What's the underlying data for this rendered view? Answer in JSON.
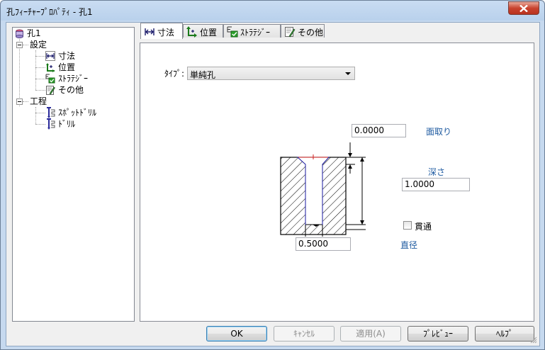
{
  "window": {
    "title": "孔ﾌｨｰﾁｬｰﾌﾟﾛﾊﾟﾃｨ - 孔1"
  },
  "tree": {
    "root": "孔1",
    "groups": [
      {
        "label": "設定",
        "items": [
          "寸法",
          "位置",
          "ｽﾄﾗﾃｼﾞｰ",
          "その他"
        ]
      },
      {
        "label": "工程",
        "items": [
          "ｽﾎﾟｯﾄﾄﾞﾘﾙ",
          "ﾄﾞﾘﾙ"
        ]
      }
    ]
  },
  "tabs": [
    {
      "label": "寸法",
      "icon": "dimension-icon",
      "selected": true
    },
    {
      "label": "位置",
      "icon": "position-icon",
      "selected": false
    },
    {
      "label": "ｽﾄﾗﾃｼﾞｰ",
      "icon": "strategy-icon",
      "selected": false
    },
    {
      "label": "その他",
      "icon": "other-icon",
      "selected": false
    }
  ],
  "form": {
    "type_label": "ﾀｲﾌﾟ:",
    "type_value": "単純孔",
    "chamfer_value": "0.0000",
    "chamfer_label": "面取り",
    "depth_label": "深さ",
    "depth_value": "1.0000",
    "through_label": "貫通",
    "through_checked": false,
    "diameter_value": "0.5000",
    "diameter_label": "直径"
  },
  "buttons": {
    "ok": "OK",
    "cancel": "ｷｬﾝｾﾙ",
    "apply": "適用(A)",
    "preview": "ﾌﾟﾚﾋﾞｭｰ",
    "help": "ﾍﾙﾌﾟ"
  },
  "colors": {
    "link": "#1e5aa0",
    "close_button": "#c9432f",
    "window_frame": "#b9d1ec"
  }
}
